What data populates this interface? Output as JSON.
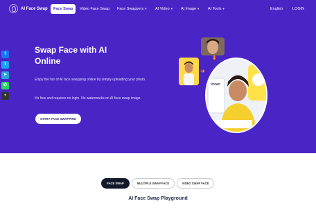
{
  "nav": {
    "logo_text": "AI Face Swap",
    "items": [
      {
        "label": "Face Swap",
        "active": true
      },
      {
        "label": "Video Face Swap"
      },
      {
        "label": "Face Swappers",
        "dropdown": true
      },
      {
        "label": "AI Video",
        "dropdown": true
      },
      {
        "label": "AI Image",
        "dropdown": true
      },
      {
        "label": "AI Tools",
        "dropdown": true
      }
    ],
    "language": "English",
    "login": "LOGIN"
  },
  "social": [
    {
      "icon": "facebook-icon",
      "glyph": "f",
      "color": "#1877f2"
    },
    {
      "icon": "twitter-icon",
      "glyph": "t",
      "color": "#1da1f2"
    },
    {
      "icon": "telegram-icon",
      "glyph": "➤",
      "color": "#2aa3df"
    },
    {
      "icon": "whatsapp-icon",
      "glyph": "✆",
      "color": "#25d366"
    },
    {
      "icon": "share-plus-icon",
      "glyph": "+",
      "color": "#333333"
    }
  ],
  "hero": {
    "title_line1": "Swap Face with AI",
    "title_line2": "Online",
    "desc1": "Enjoy the fun of AI face swapping online by simply uploading your photo.",
    "desc2": "It's free and requires no login. No watermarks on AI face swap image.",
    "cta": "START FACE SWAPPING",
    "card_text": "Imran"
  },
  "tabs": [
    {
      "label": "FACE SWAP",
      "active": true
    },
    {
      "label": "MULTIPLE SWAP FACE"
    },
    {
      "label": "VIDEO SWAP FACE"
    }
  ],
  "section_title": "AI Face Swap Playground",
  "colors": {
    "hero_bg": "#4a25c6",
    "accent_orange": "#ff8a1e"
  }
}
